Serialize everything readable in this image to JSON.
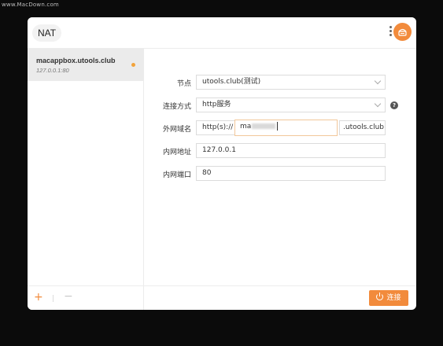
{
  "watermark": "www.MacDown.com",
  "app": {
    "title": "NAT"
  },
  "tunnels": [
    {
      "name": "macappbox.utools.club",
      "address": "127.0.0.1:80"
    }
  ],
  "form": {
    "node_label": "节点",
    "node_value": "utools.club(测试)",
    "method_label": "连接方式",
    "method_value": "http服务",
    "domain_label": "外网域名",
    "domain_prefix": "http(s)://",
    "domain_value": "ma",
    "domain_suffix": ".utools.club",
    "addr_label": "内网地址",
    "addr_value": "127.0.0.1",
    "port_label": "内网端口",
    "port_value": "80",
    "help_symbol": "?"
  },
  "footer": {
    "add_symbol": "+",
    "remove_symbol": "−",
    "connect_label": "连接"
  },
  "colors": {
    "accent": "#f28b3c",
    "status": "#f2a33a"
  },
  "icons": [
    "kebab-menu-icon",
    "user-avatar-icon",
    "chevron-down-icon",
    "help-icon",
    "power-icon"
  ]
}
